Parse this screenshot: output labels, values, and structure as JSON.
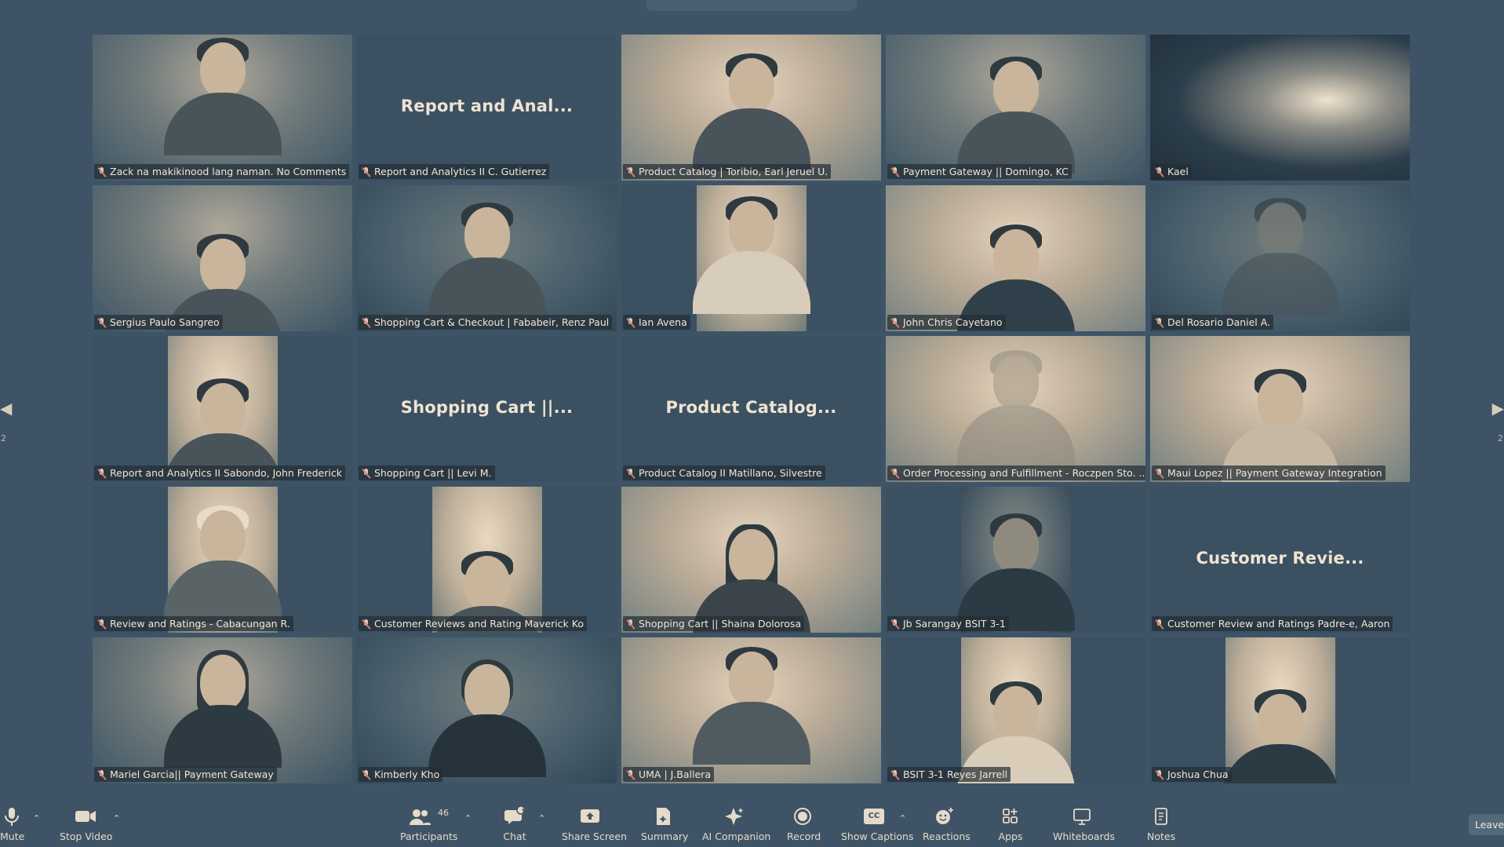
{
  "meeting": {
    "page_left": "2",
    "page_right": "2",
    "tiles": [
      {
        "name": "Zack na makikinood lang naman. No Comments",
        "video": true
      },
      {
        "name": "Report and Analytics II C. Gutierrez",
        "video": false,
        "title": "Report and Anal..."
      },
      {
        "name": "Product Catalog | Toribio, Earl Jeruel U.",
        "video": true
      },
      {
        "name": "Payment Gateway || Domingo, KC",
        "video": true
      },
      {
        "name": "Kael",
        "video": true
      },
      {
        "name": "Sergius Paulo Sangreo",
        "video": true
      },
      {
        "name": "Shopping Cart & Checkout | Fababeir, Renz Paul",
        "video": true
      },
      {
        "name": "Ian Avena",
        "video": true
      },
      {
        "name": "John Chris Cayetano",
        "video": true
      },
      {
        "name": "Del Rosario Daniel A.",
        "video": true
      },
      {
        "name": "Report and Analytics II Sabondo, John Frederick",
        "video": true
      },
      {
        "name": "Shopping Cart || Levi M.",
        "video": false,
        "title": "Shopping Cart ||..."
      },
      {
        "name": "Product Catalog II Matillano, Silvestre",
        "video": false,
        "title": "Product Catalog..."
      },
      {
        "name": "Order Processing and Fulfillment - Roczpen Sto. ...",
        "video": true
      },
      {
        "name": "Maui Lopez || Payment Gateway Integration",
        "video": true
      },
      {
        "name": "Review and Ratings - Cabacungan R.",
        "video": true
      },
      {
        "name": "Customer Reviews and Rating Maverick Ko",
        "video": true
      },
      {
        "name": "Shopping Cart || Shaina Dolorosa",
        "video": true
      },
      {
        "name": "Jb Sarangay BSIT 3-1",
        "video": true
      },
      {
        "name": "Customer Review and Ratings Padre-e, Aaron",
        "video": false,
        "title": "Customer Revie..."
      },
      {
        "name": "Mariel Garcia|| Payment Gateway",
        "video": true
      },
      {
        "name": "Kimberly Kho",
        "video": true
      },
      {
        "name": "UMA | J.Ballera",
        "video": true
      },
      {
        "name": "BSIT 3-1 Reyes Jarrell",
        "video": true
      },
      {
        "name": "Joshua Chua",
        "video": true
      }
    ]
  },
  "toolbar": {
    "mute": "Mute",
    "stop_video": "Stop Video",
    "participants": "Participants",
    "participants_count": "46",
    "chat": "Chat",
    "chat_badge": "1",
    "share_screen": "Share Screen",
    "summary": "Summary",
    "ai_companion": "AI Companion",
    "record": "Record",
    "show_captions": "Show Captions",
    "captions_icon_text": "CC",
    "reactions": "Reactions",
    "apps": "Apps",
    "whiteboards": "Whiteboards",
    "notes": "Notes",
    "leave": "Leave"
  }
}
